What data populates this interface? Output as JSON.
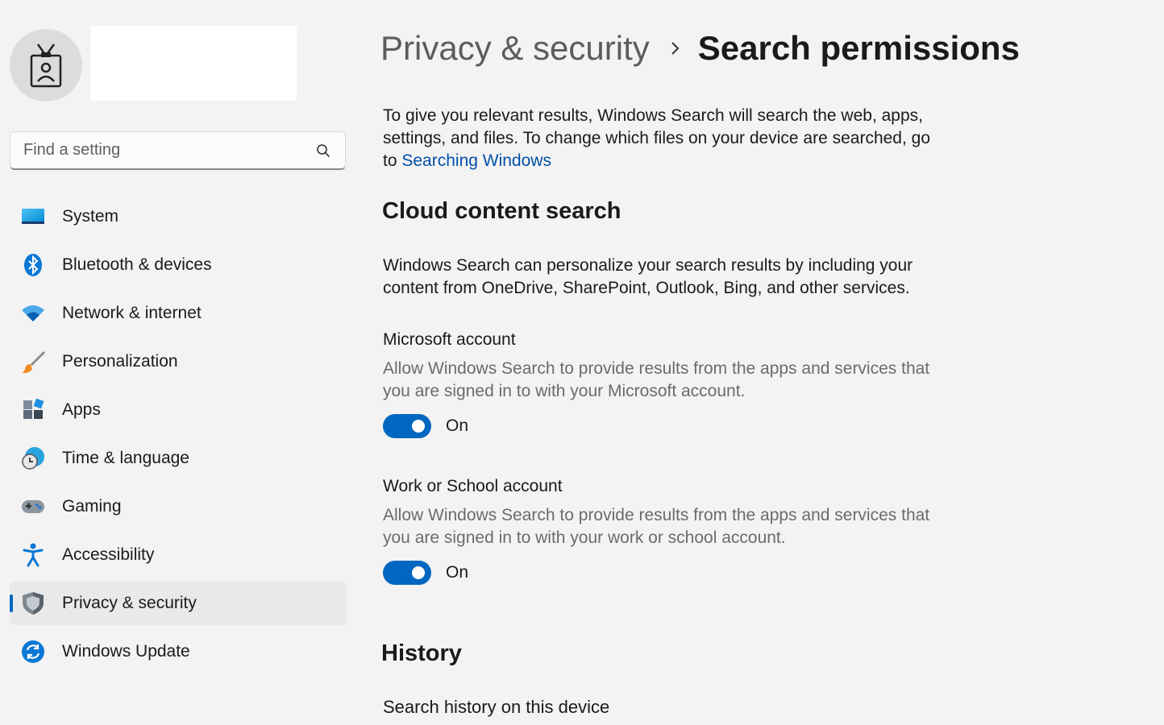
{
  "search": {
    "placeholder": "Find a setting"
  },
  "sidebar": {
    "items": [
      {
        "label": "System",
        "icon": "system-icon"
      },
      {
        "label": "Bluetooth & devices",
        "icon": "bluetooth-icon"
      },
      {
        "label": "Network & internet",
        "icon": "wifi-icon"
      },
      {
        "label": "Personalization",
        "icon": "brush-icon"
      },
      {
        "label": "Apps",
        "icon": "apps-icon"
      },
      {
        "label": "Time & language",
        "icon": "globe-clock-icon"
      },
      {
        "label": "Gaming",
        "icon": "gamepad-icon"
      },
      {
        "label": "Accessibility",
        "icon": "accessibility-icon"
      },
      {
        "label": "Privacy & security",
        "icon": "shield-icon",
        "selected": true
      },
      {
        "label": "Windows Update",
        "icon": "update-icon"
      }
    ]
  },
  "breadcrumb": {
    "parent": "Privacy & security",
    "current": "Search permissions"
  },
  "intro": {
    "text": "To give you relevant results, Windows Search will search the web, apps, settings, and files. To change which files on your device are searched, go to",
    "link": "Searching Windows"
  },
  "cloud": {
    "heading": "Cloud content search",
    "description": "Windows Search can personalize your search results by including your content from OneDrive, SharePoint, Outlook, Bing, and other services.",
    "microsoft": {
      "title": "Microsoft account",
      "description": "Allow Windows Search to provide results from the apps and services that you are signed in to with your Microsoft account.",
      "state": "On"
    },
    "work": {
      "title": "Work or School account",
      "description": "Allow Windows Search to provide results from the apps and services that you are signed in to with your work or school account.",
      "state": "On"
    }
  },
  "history": {
    "heading": "History",
    "item_title": "Search history on this device"
  },
  "colors": {
    "accent": "#0067c0",
    "link": "#0050a8",
    "background": "#f3f3f3"
  }
}
